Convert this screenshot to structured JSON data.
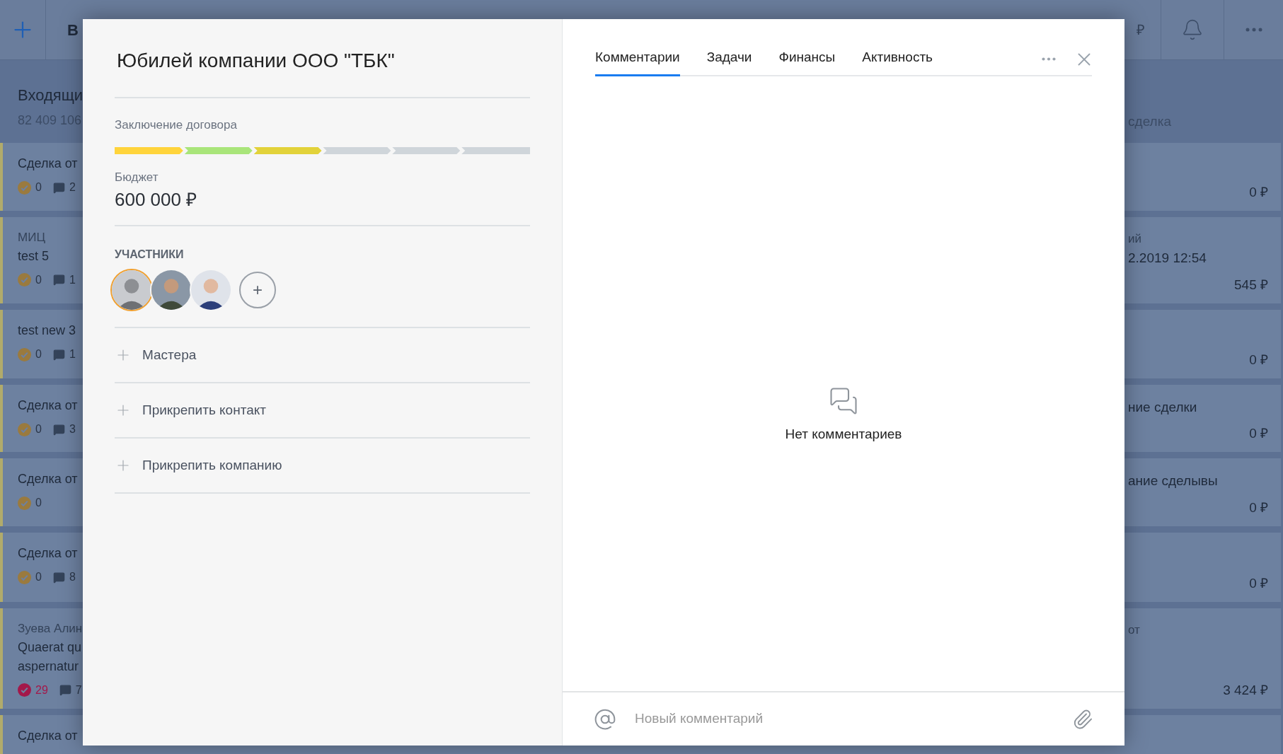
{
  "top_bar": {
    "title": "В",
    "currency": "₽"
  },
  "column_heading": {
    "title": "Входящи",
    "amount": "82 409 106",
    "right_text": "сделка"
  },
  "cards": [
    {
      "title": "Сделка от",
      "tasks": "0",
      "overdue": false,
      "comments": "2",
      "amount": "0 ₽"
    },
    {
      "label": "МИЦ",
      "title": "test 5",
      "tasks": "0",
      "overdue": false,
      "comments": "1",
      "right_label": "ий",
      "right_title": "2.2019 12:54",
      "amount": "545 ₽"
    },
    {
      "title": "test new 3",
      "tasks": "0",
      "overdue": false,
      "comments": "1",
      "amount": "0 ₽"
    },
    {
      "title": "Сделка от",
      "tasks": "0",
      "overdue": false,
      "comments": "3",
      "right_title": "ние сделки",
      "amount": "0 ₽"
    },
    {
      "title": "Сделка от",
      "tasks": "0",
      "overdue": false,
      "right_title": "ание сделывы",
      "amount": "0 ₽"
    },
    {
      "title": "Сделка от",
      "tasks": "0",
      "overdue": false,
      "comments": "8",
      "amount": "0 ₽"
    },
    {
      "label": "Зуева Алин",
      "title": "Quaerat qu aspernatur",
      "tasks": "29",
      "overdue": true,
      "comments": "7",
      "right_label": "от",
      "amount": "3 424 ₽"
    },
    {
      "title": "Сделка от"
    }
  ],
  "modal": {
    "title": "Юбилей компании ООО \"ТБК\"",
    "stage": "Заключение договора",
    "pipeline": [
      {
        "color": "#ffd43b"
      },
      {
        "color": "#a9e57a"
      },
      {
        "color": "#e2d23a"
      },
      {
        "color": "#cfd5da"
      },
      {
        "color": "#cfd5da"
      },
      {
        "color": "#cfd5da"
      }
    ],
    "budget_label": "Бюджет",
    "budget": "600 000 ₽",
    "participants_heading": "УЧАСТНИКИ",
    "participants": [
      {
        "selected": true
      },
      {
        "selected": false
      },
      {
        "selected": false
      }
    ],
    "add_participant": "+",
    "actions": [
      "Мастера",
      "Прикрепить контакт",
      "Прикрепить компанию"
    ],
    "tabs": [
      {
        "label": "Комментарии",
        "selected": true
      },
      {
        "label": "Задачи",
        "selected": false
      },
      {
        "label": "Финансы",
        "selected": false
      },
      {
        "label": "Активность",
        "selected": false
      }
    ],
    "empty_text": "Нет комментариев",
    "comment": {
      "placeholder": "Новый комментарий"
    }
  }
}
